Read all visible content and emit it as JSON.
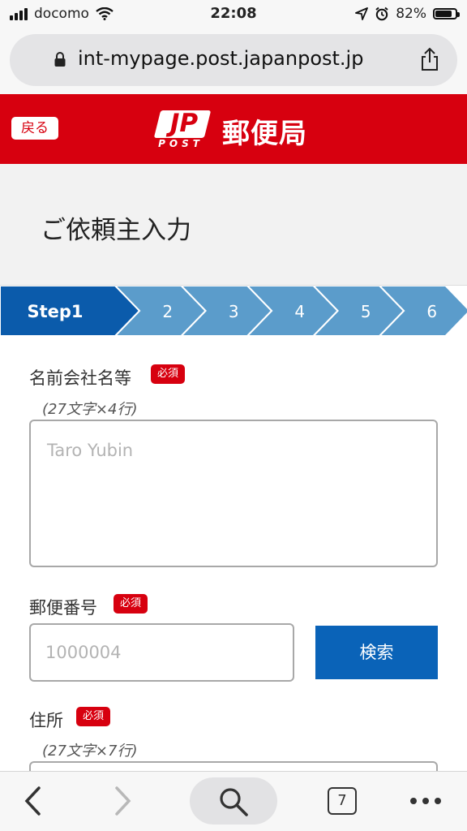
{
  "status_bar": {
    "carrier": "docomo",
    "time": "22:08",
    "battery_percent": "82%",
    "battery_level": 0.82
  },
  "browser": {
    "url": "int-mypage.post.japanpost.jp",
    "tab_count": "7"
  },
  "header": {
    "back_label": "戻る",
    "logo_jp": "JP",
    "logo_post": "POST",
    "brand": "郵便局",
    "brand_color": "#d7000f"
  },
  "page": {
    "title": "ご依頼主入力"
  },
  "steps": {
    "items": [
      "Step1",
      "2",
      "3",
      "4",
      "5",
      "6"
    ],
    "active_index": 0,
    "active_color": "#0b5bab",
    "inactive_color": "#5b9ccb"
  },
  "form": {
    "name": {
      "label": "名前会社名等",
      "required": "必須",
      "hint": "(27文字×4行)",
      "placeholder": "Taro Yubin"
    },
    "postal": {
      "label": "郵便番号",
      "required": "必須",
      "placeholder": "1000004",
      "search_label": "検索"
    },
    "address": {
      "label": "住所",
      "required": "必須",
      "hint": "(27文字×7行)"
    }
  }
}
